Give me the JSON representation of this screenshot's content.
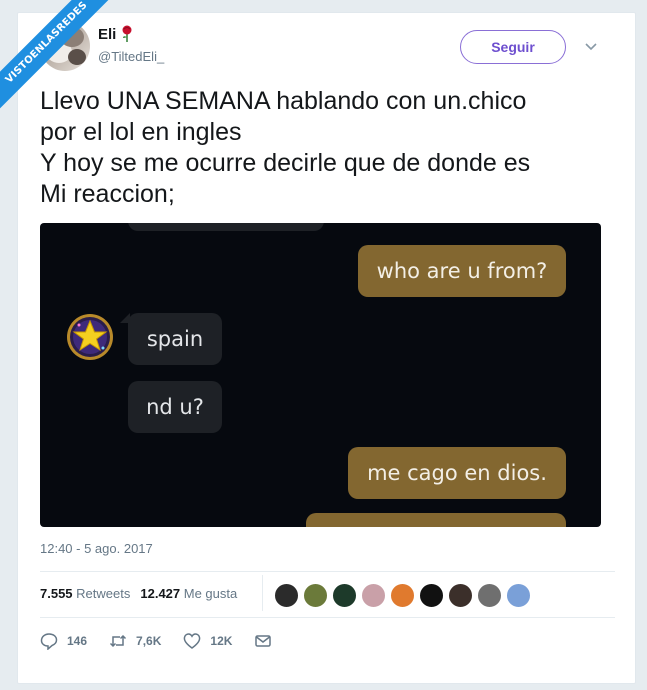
{
  "watermark": "VISTOENLASREDES",
  "user": {
    "display_name": "Eli",
    "handle": "@TiltedEli_"
  },
  "follow_label": "Seguir",
  "tweet_lines": [
    "Llevo UNA SEMANA hablando con un.chico",
    "por el lol en ingles",
    "Y hoy se me ocurre decirle que de donde es",
    "Mi reaccion;"
  ],
  "chat": {
    "messages": [
      {
        "from": "me",
        "text": "who are u from?"
      },
      {
        "from": "other",
        "text": "spain"
      },
      {
        "from": "other",
        "text": "nd u?"
      },
      {
        "from": "me",
        "text": "me cago en dios."
      }
    ]
  },
  "timestamp": "12:40 - 5 ago. 2017",
  "stats": {
    "retweets_count": "7.555",
    "retweets_label": "Retweets",
    "likes_count": "12.427",
    "likes_label": "Me gusta"
  },
  "liker_colors": [
    "#2b2b2b",
    "#6b7a3a",
    "#1d3a2a",
    "#c9a0a8",
    "#e07a2e",
    "#111111",
    "#3b2f2a",
    "#6f6f6f",
    "#7aa0d8"
  ],
  "actions": {
    "replies": "146",
    "retweets": "7,6K",
    "likes": "12K"
  },
  "colors": {
    "accent": "#6e4fcf",
    "ribbon": "#1f8fe0",
    "bubble_out": "#836730",
    "bubble_in": "#1e2126"
  }
}
